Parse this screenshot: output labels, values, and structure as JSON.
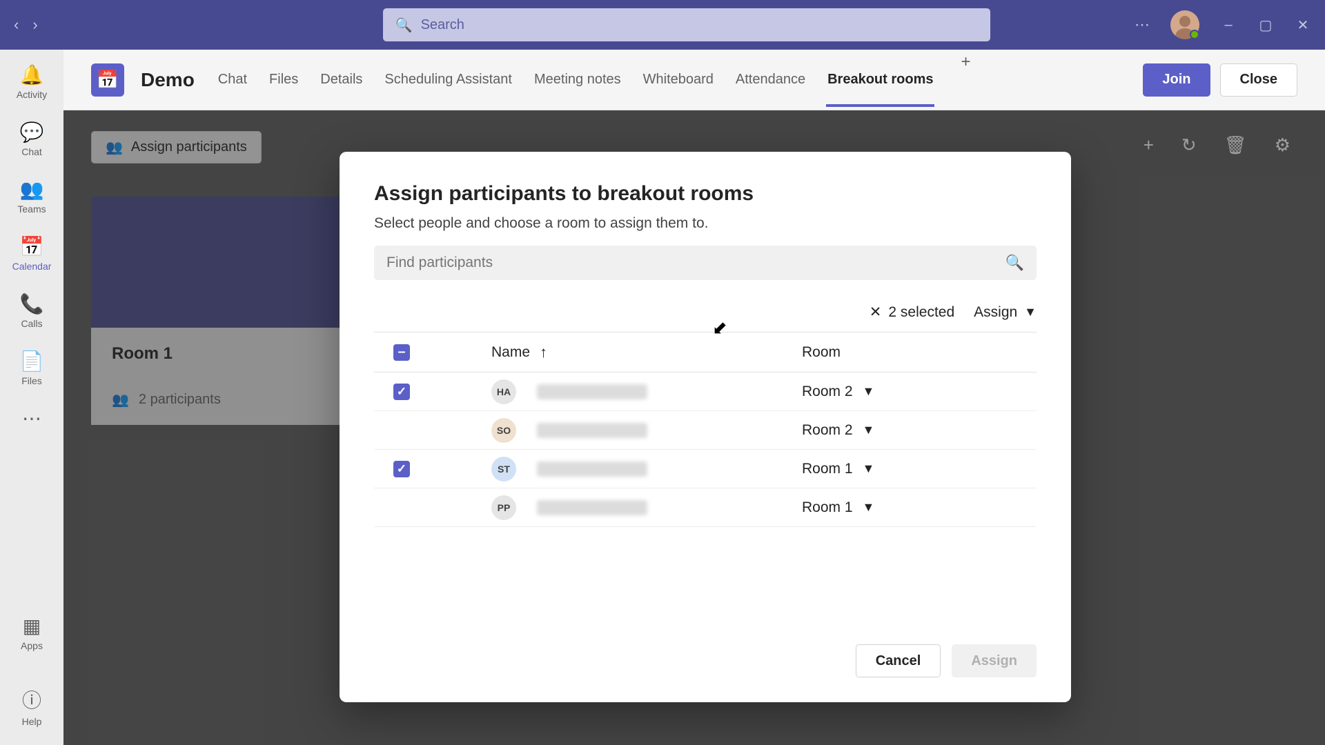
{
  "titlebar": {
    "search_placeholder": "Search"
  },
  "left_rail": {
    "items": [
      {
        "label": "Activity"
      },
      {
        "label": "Chat"
      },
      {
        "label": "Teams"
      },
      {
        "label": "Calendar"
      },
      {
        "label": "Calls"
      },
      {
        "label": "Files"
      }
    ],
    "apps_label": "Apps",
    "help_label": "Help"
  },
  "meeting": {
    "title": "Demo",
    "tabs": [
      "Chat",
      "Files",
      "Details",
      "Scheduling Assistant",
      "Meeting notes",
      "Whiteboard",
      "Attendance",
      "Breakout rooms"
    ],
    "join_label": "Join",
    "close_label": "Close"
  },
  "breakout": {
    "assign_button": "Assign participants",
    "room_name": "Room 1",
    "participant_count": "2 participants"
  },
  "dialog": {
    "title": "Assign participants to breakout rooms",
    "subtitle": "Select people and choose a room to assign them to.",
    "find_placeholder": "Find participants",
    "selected_text": "2 selected",
    "assign_dropdown": "Assign",
    "header_name": "Name",
    "header_room": "Room",
    "rows": [
      {
        "initials": "HA",
        "avatar_bg": "#e5e5e5",
        "room": "Room 2",
        "checked": true
      },
      {
        "initials": "SO",
        "avatar_bg": "#f0e0d0",
        "room": "Room 2",
        "checked": false
      },
      {
        "initials": "ST",
        "avatar_bg": "#d0e0f5",
        "room": "Room 1",
        "checked": true
      },
      {
        "initials": "PP",
        "avatar_bg": "#e5e5e5",
        "room": "Room 1",
        "checked": false
      }
    ],
    "cancel_label": "Cancel",
    "assign_label": "Assign"
  }
}
